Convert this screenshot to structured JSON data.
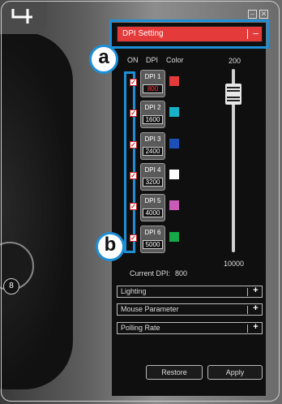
{
  "window": {
    "minimize_icon": "minimize-icon",
    "close_icon": "close-icon"
  },
  "logo": {
    "icon": "logo-icon",
    "text": "4"
  },
  "device_label": "8",
  "dpi_setting": {
    "title": "DPI Setting",
    "collapse_symbol": "−",
    "columns": {
      "on": "ON",
      "dpi": "DPI",
      "color": "Color"
    },
    "profiles": [
      {
        "name": "DPI 1",
        "value": "800",
        "on": true,
        "color": "#e53a3a",
        "value_color": "#ff3b3b"
      },
      {
        "name": "DPI 2",
        "value": "1600",
        "on": true,
        "color": "#16b3c8",
        "value_color": "#ffffff"
      },
      {
        "name": "DPI 3",
        "value": "2400",
        "on": true,
        "color": "#1c4fb8",
        "value_color": "#ffffff"
      },
      {
        "name": "DPI 4",
        "value": "3200",
        "on": true,
        "color": "#ffffff",
        "value_color": "#ffffff"
      },
      {
        "name": "DPI 5",
        "value": "4000",
        "on": true,
        "color": "#c85bb8",
        "value_color": "#ffffff"
      },
      {
        "name": "DPI 6",
        "value": "5000",
        "on": true,
        "color": "#17a84a",
        "value_color": "#ffffff"
      }
    ],
    "slider": {
      "max_label": "200",
      "min_label": "10000"
    },
    "current_label": "Current DPI:",
    "current_value": "800"
  },
  "sections": [
    {
      "label": "Lighting",
      "symbol": "+"
    },
    {
      "label": "Mouse Parameter",
      "symbol": "+"
    },
    {
      "label": "Polling Rate",
      "symbol": "+"
    }
  ],
  "buttons": {
    "restore": "Restore",
    "apply": "Apply"
  },
  "callouts": {
    "a": "a",
    "b": "b"
  },
  "colors": {
    "accent": "#e53a3a",
    "highlight": "#1e8fd6"
  }
}
